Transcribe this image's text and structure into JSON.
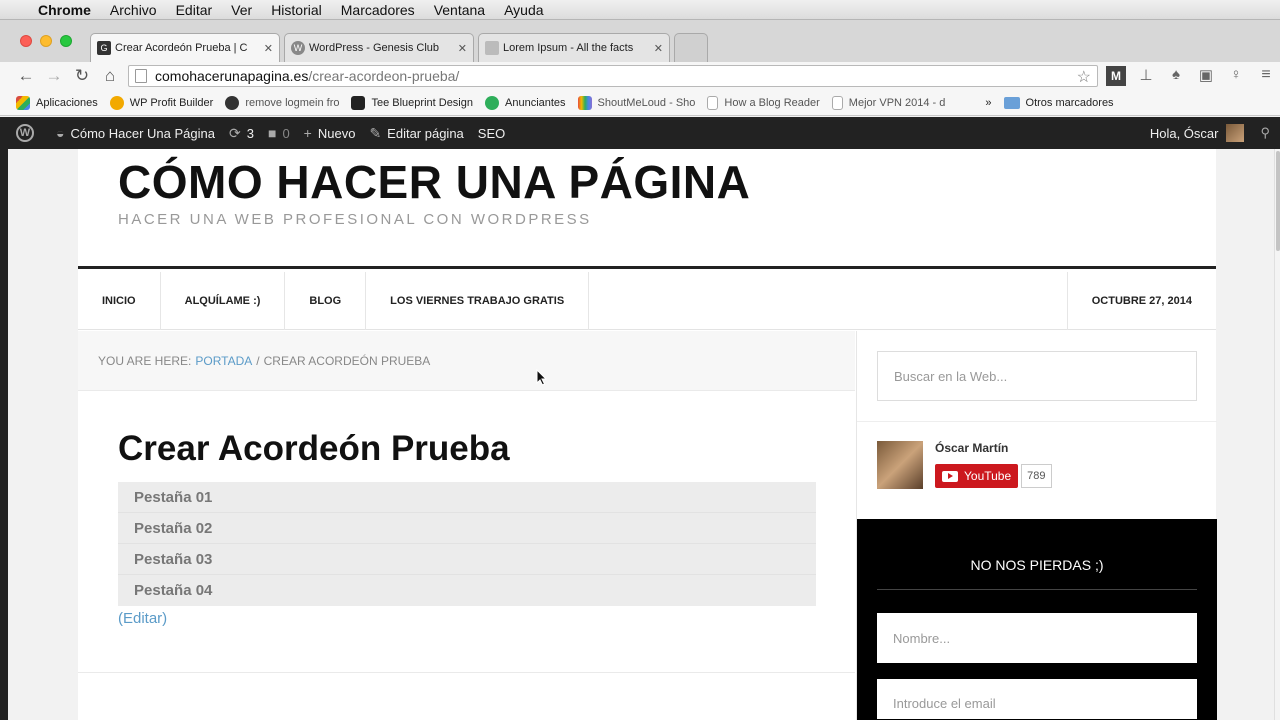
{
  "mac_menu": {
    "items": [
      "Chrome",
      "Archivo",
      "Editar",
      "Ver",
      "Historial",
      "Marcadores",
      "Ventana",
      "Ayuda"
    ]
  },
  "tabs": [
    {
      "label": "Crear Acordeón Prueba | C",
      "active": true
    },
    {
      "label": "WordPress - Genesis Club",
      "active": false
    },
    {
      "label": "Lorem Ipsum - All the facts",
      "active": false
    }
  ],
  "omnibox": {
    "host": "comohacerunapagina.es",
    "path": "/crear-acordeon-prueba/"
  },
  "bookmarks": [
    {
      "label": "Aplicaciones",
      "color": "#d94d3e"
    },
    {
      "label": "WP Profit Builder",
      "color": "#f2a900"
    },
    {
      "label": "remove logmein fro",
      "color": "#333333"
    },
    {
      "label": "Tee Blueprint Design",
      "color": "#222222"
    },
    {
      "label": "Anunciantes",
      "color": "#2eae5a"
    },
    {
      "label": "ShoutMeLoud - Sho",
      "color": "#8a6fd1"
    },
    {
      "label": "How a Blog Reader",
      "color": "#ffffff"
    },
    {
      "label": "Mejor VPN 2014 - d",
      "color": "#ffffff"
    },
    {
      "label": "Otros marcadores",
      "color": "#6aa0d8"
    }
  ],
  "adminbar": {
    "site": "Cómo Hacer Una Página",
    "updates": "3",
    "comments": "0",
    "new": "Nuevo",
    "edit": "Editar página",
    "seo": "SEO",
    "greeting": "Hola, Óscar"
  },
  "site": {
    "title": "CÓMO HACER UNA PÁGINA",
    "description": "HACER UNA WEB PROFESIONAL CON WORDPRESS"
  },
  "nav": {
    "items": [
      "INICIO",
      "ALQUÍLAME :)",
      "BLOG",
      "LOS VIERNES TRABAJO GRATIS"
    ],
    "date": "OCTUBRE 27, 2014"
  },
  "breadcrumb": {
    "prefix": "YOU ARE HERE:",
    "home": "PORTADA",
    "sep": "/",
    "current": "CREAR ACORDEÓN PRUEBA"
  },
  "post": {
    "title": "Crear Acordeón Prueba",
    "accordion": [
      "Pestaña 01",
      "Pestaña 02",
      "Pestaña 03",
      "Pestaña 04"
    ],
    "edit_link": "(Editar)"
  },
  "sidebar": {
    "search_placeholder": "Buscar en la Web...",
    "author_name": "Óscar Martín",
    "youtube_label": "YouTube",
    "youtube_count": "789",
    "newsletter_title": "NO NOS PIERDAS ;)",
    "name_placeholder": "Nombre...",
    "email_placeholder": "Introduce el email"
  }
}
